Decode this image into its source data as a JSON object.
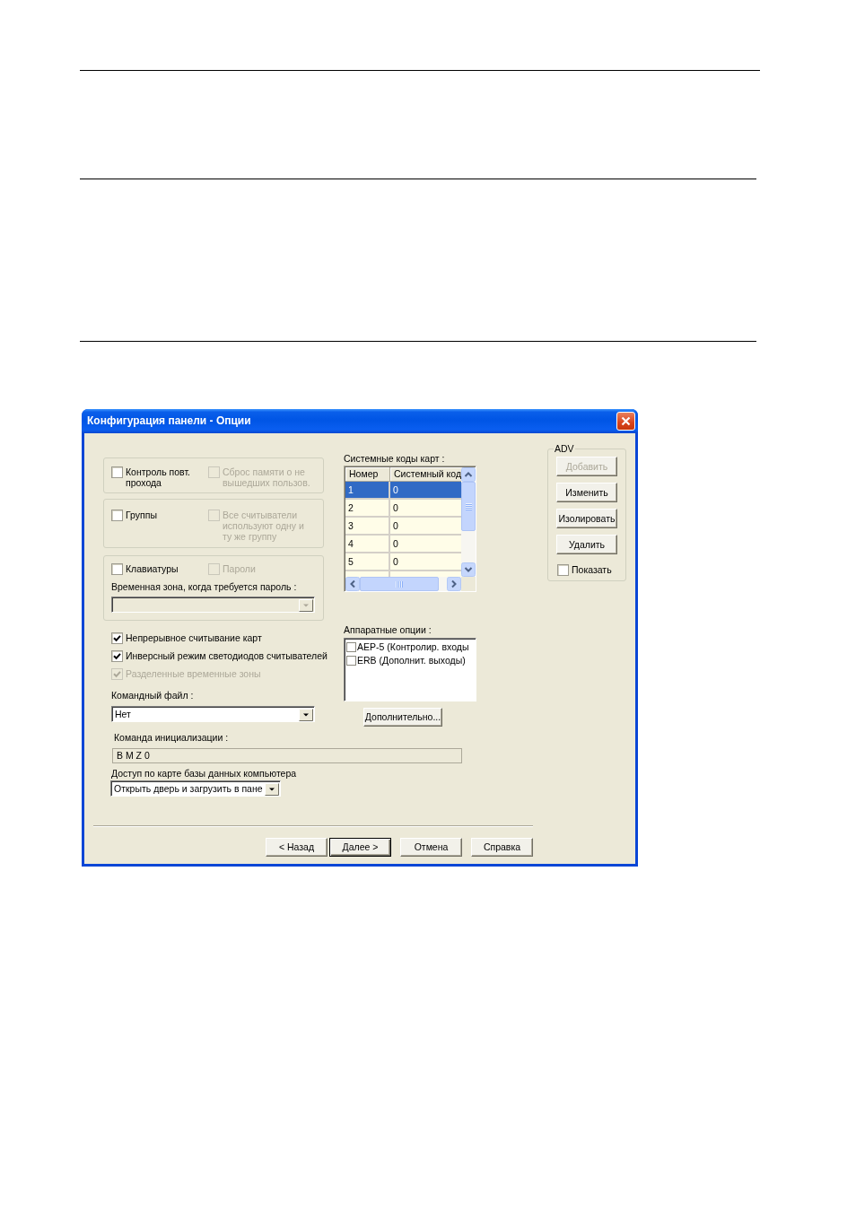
{
  "dialog": {
    "title": "Конфигурация панели - Опции",
    "option_groups": [
      {
        "options": [
          {
            "label": "Контроль повт. прохода",
            "checked": false,
            "disabled": false
          },
          {
            "label": "Сброс памяти о не вышедших пользов.",
            "checked": false,
            "disabled": true
          }
        ]
      },
      {
        "options": [
          {
            "label": "Группы",
            "checked": false,
            "disabled": false
          },
          {
            "label": "Все считыватели используют одну и ту же группу",
            "checked": false,
            "disabled": true
          }
        ]
      },
      {
        "options": [
          {
            "label": "Клавиатуры",
            "checked": false,
            "disabled": false
          },
          {
            "label": "Пароли",
            "checked": false,
            "disabled": true
          }
        ],
        "time_zone": {
          "label": "Временная зона, когда требуется пароль :",
          "disabled": true
        }
      }
    ],
    "checkboxes": [
      {
        "label": "Непрерывное считывание карт",
        "checked": true,
        "disabled": false
      },
      {
        "label": "Инверсный режим светодиодов считывателей",
        "checked": true,
        "disabled": false
      },
      {
        "label": "Разделенные временные зоны",
        "checked": true,
        "disabled": true
      }
    ],
    "command_file": {
      "label": "Командный файл :",
      "value": "Нет",
      "disabled": false
    },
    "card_codes": {
      "label": "Системные коды карт :",
      "columns": [
        "Номер",
        "Системный код"
      ],
      "rows": [
        {
          "cells": [
            "1",
            "0"
          ],
          "selected": true
        },
        {
          "cells": [
            "2",
            "0"
          ],
          "selected": false
        },
        {
          "cells": [
            "3",
            "0"
          ],
          "selected": false
        },
        {
          "cells": [
            "4",
            "0"
          ],
          "selected": false
        },
        {
          "cells": [
            "5",
            "0"
          ],
          "selected": false
        }
      ]
    },
    "hardware_options": {
      "label": "Аппаратные опции :",
      "items": [
        {
          "label": "AEP-5 (Контролир. входы",
          "checked": false
        },
        {
          "label": "ERB (Дополнит. выходы)",
          "checked": false
        }
      ]
    },
    "more_button": {
      "label": "Дополнительно..."
    },
    "adv": {
      "title": "ADV",
      "buttons": [
        {
          "label": "Добавить",
          "disabled": true
        },
        {
          "label": "Изменить",
          "disabled": false
        },
        {
          "label": "Изолировать",
          "disabled": false
        },
        {
          "label": "Удалить",
          "disabled": false
        }
      ],
      "show": {
        "label": "Показать",
        "checked": false
      }
    },
    "init_command": {
      "label": "Команда инициализации :",
      "value": "B M Z 0",
      "read_only": true
    },
    "db_access": {
      "label": "Доступ по карте базы данных компьютера",
      "value": "Открыть дверь и загрузить в пане"
    },
    "buttons": [
      {
        "label": "< Назад",
        "default": false
      },
      {
        "label": "Далее >",
        "default": true
      },
      {
        "label": "Отмена",
        "default": false
      },
      {
        "label": "Справка",
        "default": false
      }
    ]
  }
}
